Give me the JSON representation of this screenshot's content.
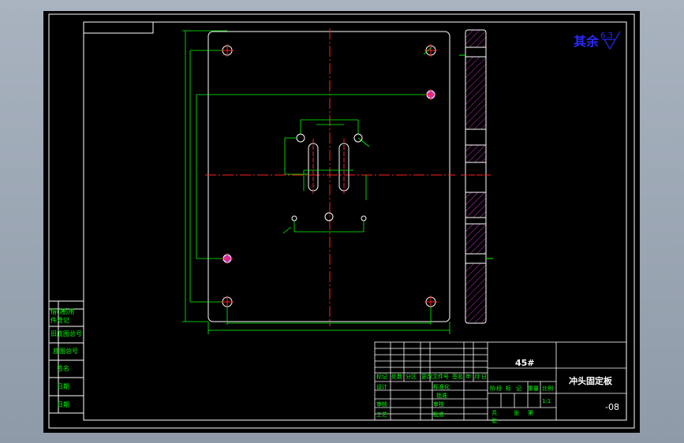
{
  "drawing": {
    "surface_note": "其余",
    "roughness_value": "6.3",
    "material": "45#",
    "part_name": "冲头固定板",
    "drawing_number": "-08",
    "scale_value": "1:1"
  },
  "left_stamp": {
    "rows": [
      "借(通)用",
      "件登记",
      "旧底图总号",
      "底图总号",
      "签名",
      "日期",
      "日期"
    ]
  },
  "title_block": {
    "header_labels": [
      "标记",
      "处数",
      "分区",
      "更改文件号",
      "签名",
      "年",
      "月",
      "日"
    ],
    "role_labels": [
      "设计",
      "审核",
      "工艺"
    ],
    "std_labels": [
      "标准化",
      "批准",
      "审核",
      "批准"
    ],
    "stage_labels": [
      "阶",
      "段",
      "标",
      "记",
      "重量",
      "比例"
    ],
    "sheet_labels": [
      "共",
      "张",
      "第",
      "张"
    ]
  },
  "colors": {
    "background": "#000000",
    "frame": "#ffffff",
    "dimension": "#00ff00",
    "centerline": "#ff0000",
    "hatch": "#cc33cc",
    "note": "#2a2aff",
    "sheet_bg": "#9aa4b1"
  }
}
